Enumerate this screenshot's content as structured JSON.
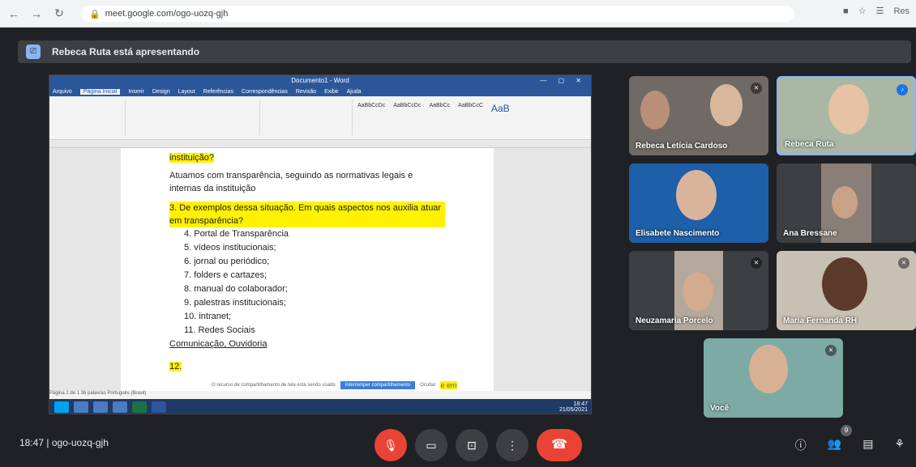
{
  "browser": {
    "url": "meet.google.com/ogo-uozq-gjh",
    "ext1": "■",
    "ext2": "☆",
    "ext3": "☰",
    "ext4": "Res"
  },
  "banner": {
    "icon": "⎚",
    "text": "Rebeca Ruta está apresentando"
  },
  "word": {
    "title": "Documento1 - Word",
    "window_controls": "— ▢ ✕",
    "tabs": [
      "Arquivo",
      "Página Inicial",
      "Inserir",
      "Design",
      "Layout",
      "Referências",
      "Correspondências",
      "Revisão",
      "Exibir",
      "Ajuda"
    ],
    "styles": [
      "AaBbCcDc",
      "AaBbCcDc",
      "AaBbCc",
      "AaBbCcC",
      "AaB"
    ],
    "doc": {
      "q_tail": "instituição?",
      "answer": "Atuamos com transparência, seguindo as normativas legais e internas da instituição",
      "q3_number": "3.",
      "q3_text": "De exemplos dessa situação. Em quais aspectos nos auxilia atuar em transparência?",
      "items": [
        "4. Portal de Transparência",
        "5. vídeos institucionais;",
        "6. jornal ou periódico;",
        "7. folders e cartazes;",
        "8. manual do colaborador;",
        "9. palestras institucionais;",
        "10. intranet;",
        "11. Redes Sociais"
      ],
      "footer_line": "Comunicação, Ouvidoria",
      "q12_number": "12.",
      "q12_tail": "e em"
    },
    "notif_text": "O recurso de compartilhamento de tela está sendo usado",
    "notif_button": "Interromper compartilhamento",
    "notif_hide": "Ocultar",
    "statusbar": "Página 1 de 1   36 palavras   Português (Brasil)",
    "clock_time": "18:47",
    "clock_date": "21/05/2021"
  },
  "participants": [
    {
      "name": "Rebeca Letícia Cardoso"
    },
    {
      "name": "Rebeca Ruta"
    },
    {
      "name": "Elisabete Nascimento"
    },
    {
      "name": "Ana Bressane"
    },
    {
      "name": "Neuzamaria Porcelo"
    },
    {
      "name": "Maria Fernanda RH"
    },
    {
      "name": "Você"
    }
  ],
  "controls": {
    "time": "18:47",
    "separator": "|",
    "meeting_code": "ogo-uozq-gjh",
    "mic_icon": "mic-off-icon",
    "cam_icon": "camera-icon",
    "present_icon": "present-icon",
    "more_icon": "more-icon",
    "end_icon": "end-call-icon",
    "people_count": "9"
  },
  "colors": {
    "accent_red": "#ea4335",
    "meet_bg": "#202124",
    "word_blue": "#2b579a",
    "highlight": "#fff200"
  }
}
